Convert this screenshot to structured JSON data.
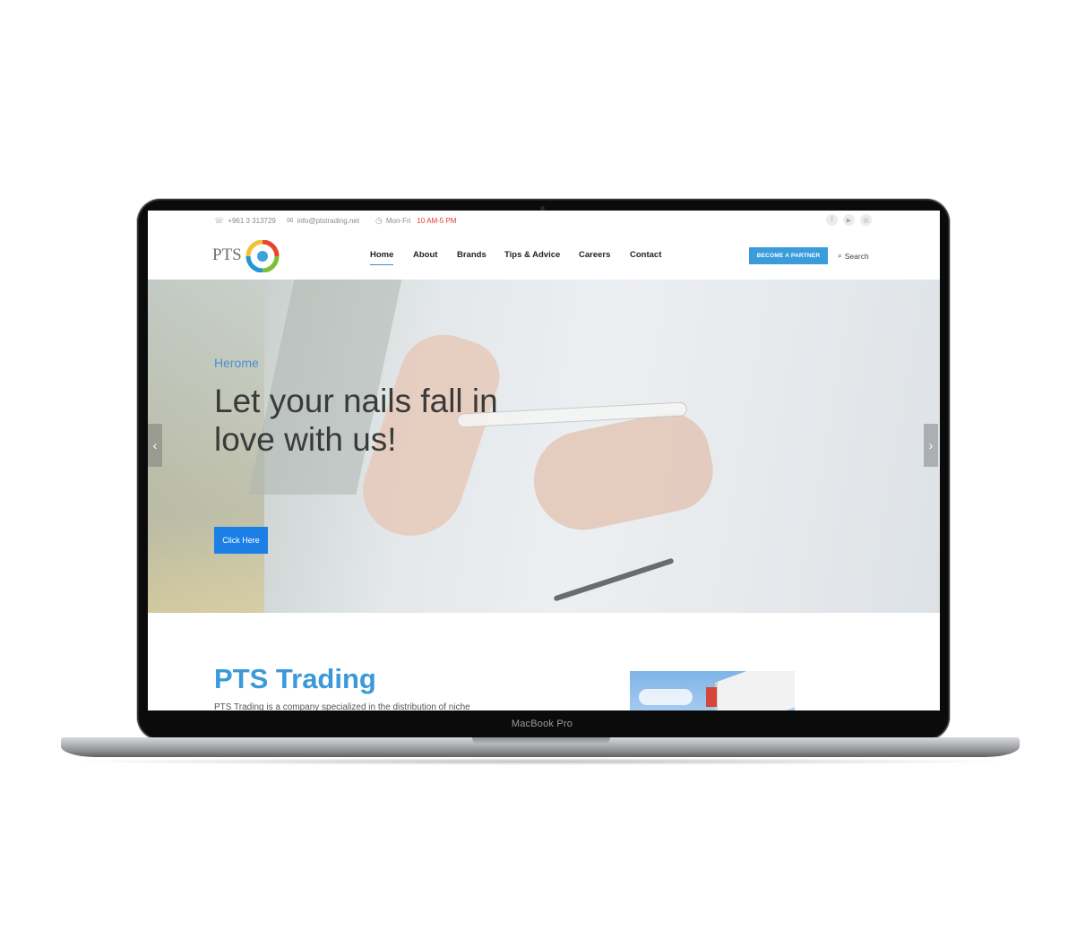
{
  "topbar": {
    "phone": "+961 3 313729",
    "email": "info@ptstrading.net",
    "hours_label": "Mon-Fri",
    "hours_value": "10 AM-5 PM",
    "social": [
      "facebook-icon",
      "youtube-icon",
      "instagram-icon"
    ]
  },
  "logo": {
    "text": "PTS"
  },
  "nav": {
    "items": [
      "Home",
      "About",
      "Brands",
      "Tips & Advice",
      "Careers",
      "Contact"
    ],
    "active": "Home",
    "partner_button": "BECOME A PARTNER",
    "search_label": "Search"
  },
  "hero": {
    "subtitle": "Herome",
    "title": "Let your nails fall in love with us!",
    "button": "Click Here"
  },
  "section": {
    "title": "PTS Trading",
    "text": "PTS Trading is a company specialized in the distribution of niche"
  },
  "device": {
    "label": "MacBook Pro"
  },
  "colors": {
    "accent": "#3a9cdb",
    "hero_button": "#1c7fe6",
    "hours": "#e0382b",
    "title": "#3a9ad9"
  }
}
